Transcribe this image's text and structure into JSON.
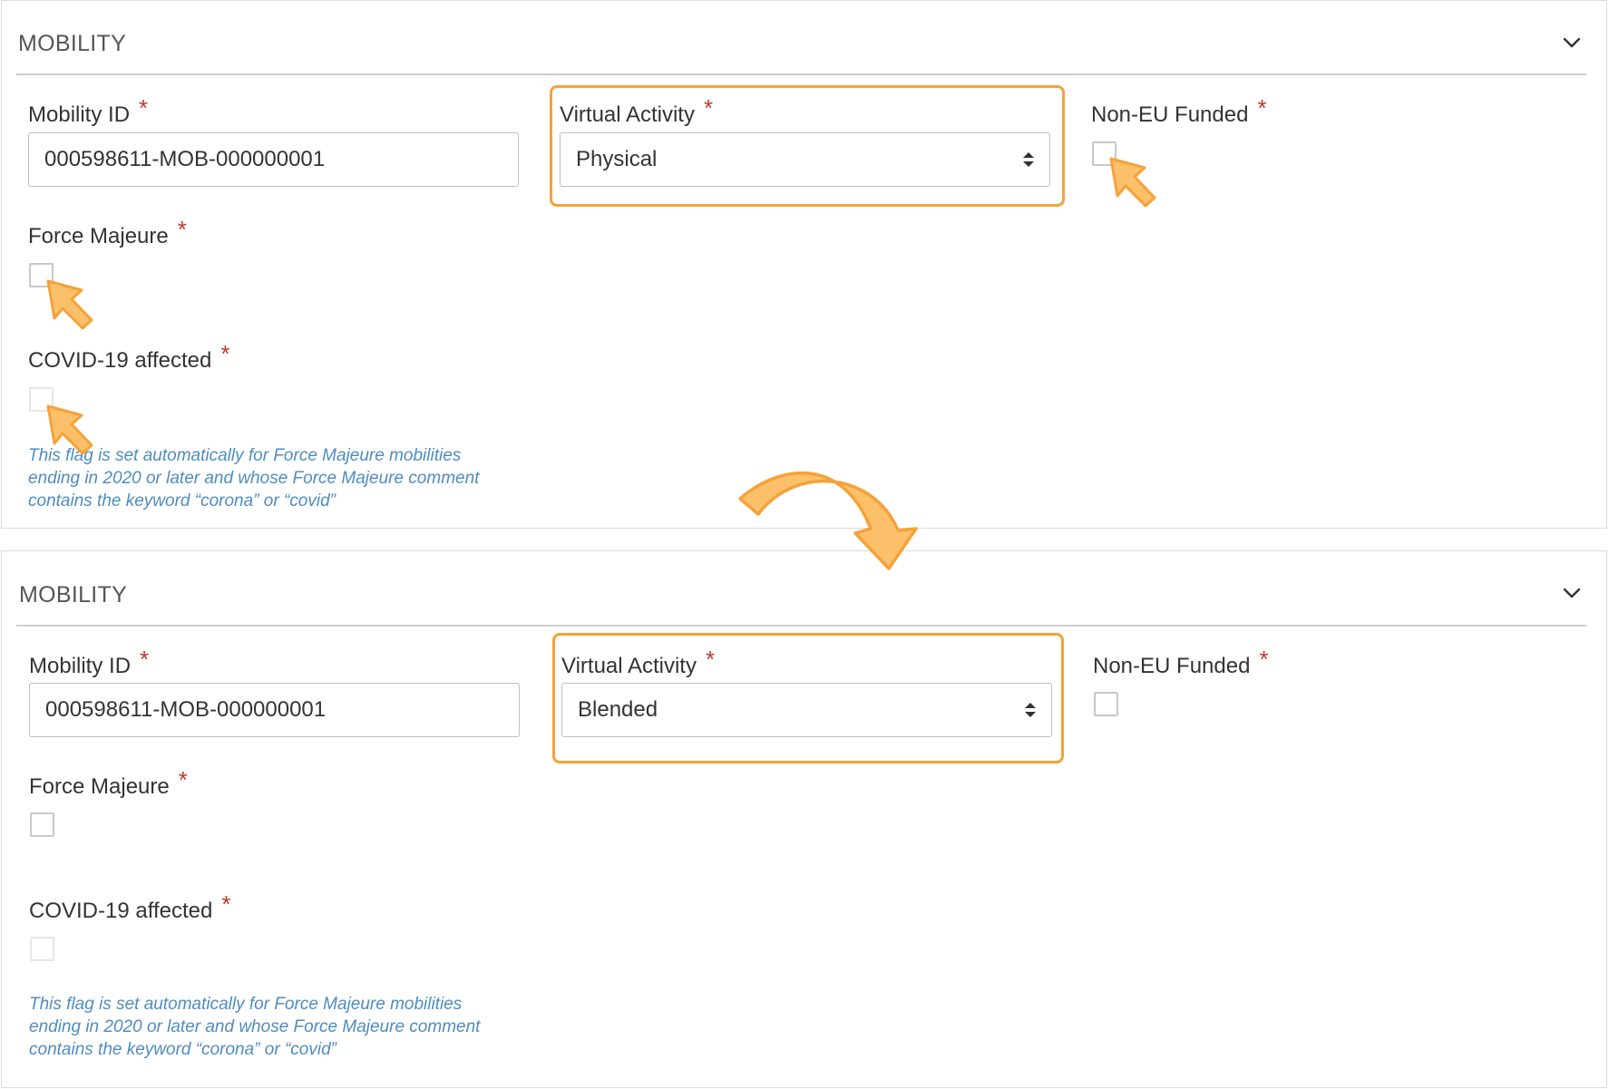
{
  "panels": [
    {
      "title": "MOBILITY",
      "mobility_id_label": "Mobility ID",
      "mobility_id_value": "000598611-MOB-000000001",
      "virtual_activity_label": "Virtual Activity",
      "virtual_activity_value": "Physical",
      "non_eu_funded_label": "Non-EU Funded",
      "force_majeure_label": "Force Majeure",
      "covid_label": "COVID-19 affected",
      "required_mark": "*",
      "hint_lines": [
        "This flag is set automatically for Force Majeure mobilities",
        "ending in 2020 or later and whose Force Majeure comment",
        "contains the keyword “corona” or “covid”"
      ]
    },
    {
      "title": "MOBILITY",
      "mobility_id_label": "Mobility ID",
      "mobility_id_value": "000598611-MOB-000000001",
      "virtual_activity_label": "Virtual Activity",
      "virtual_activity_value": "Blended",
      "non_eu_funded_label": "Non-EU Funded",
      "force_majeure_label": "Force Majeure",
      "covid_label": "COVID-19 affected",
      "required_mark": "*",
      "hint_lines": [
        "This flag is set automatically for Force Majeure mobilities",
        "ending in 2020 or later and whose Force Majeure comment",
        "contains the keyword “corona” or “covid”"
      ]
    }
  ],
  "icons": {
    "collapse": "chevron-down-icon",
    "select": "select-arrows-icon",
    "pointer": "pointer-arrow-icon",
    "transition": "curved-arrow-icon"
  },
  "colors": {
    "highlight": "#f5a23a",
    "pointer_fill": "#fcc06a",
    "required": "#c0392b",
    "hint": "#4f8cc0"
  }
}
